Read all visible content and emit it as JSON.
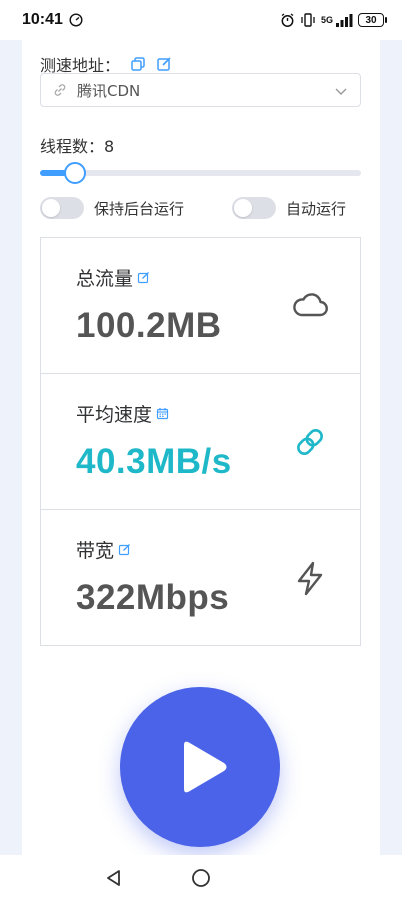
{
  "status_bar": {
    "time": "10:41",
    "network": "5G",
    "battery": "30"
  },
  "speed_test": {
    "address_label": "测速地址：",
    "selected_server": "腾讯CDN",
    "threads_label": "线程数：8",
    "threads_value": 8,
    "threads_fraction": 0.11,
    "keep_background_label": "保持后台运行",
    "keep_background_on": false,
    "auto_run_label": "自动运行",
    "auto_run_on": false
  },
  "stats": [
    {
      "title": "总流量",
      "value": "100.2MB",
      "icon": "cloud-icon",
      "title_icon": "edit-icon",
      "color": "#555555"
    },
    {
      "title": "平均速度",
      "value": "40.3MB/s",
      "icon": "link-icon",
      "title_icon": "calendar-icon",
      "color": "#1fb8c9"
    },
    {
      "title": "带宽",
      "value": "322Mbps",
      "icon": "lightning-icon",
      "title_icon": "edit-icon",
      "color": "#555555"
    }
  ],
  "colors": {
    "accent": "#409eff",
    "play_button": "#4a63e8",
    "speed_value": "#1fb8c9"
  }
}
